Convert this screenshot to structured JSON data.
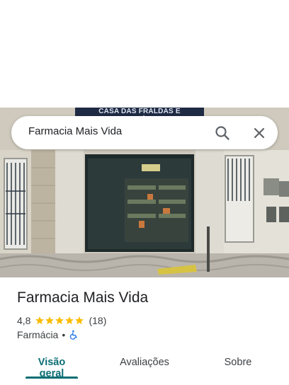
{
  "photo": {
    "sign_text": "CASA DAS FRALDAS E ORTOPÉDICA"
  },
  "search": {
    "query": "Farmacia Mais Vida",
    "icons": [
      "search-icon",
      "close-icon"
    ]
  },
  "place": {
    "name": "Farmacia Mais Vida",
    "rating": "4,8",
    "stars": 5,
    "review_count": "(18)",
    "category": "Farmácia",
    "separator": "•",
    "accessibility_icon": "wheelchair-icon"
  },
  "tabs": [
    {
      "label": "Visão geral",
      "active": true
    },
    {
      "label": "Avaliações",
      "active": false
    },
    {
      "label": "Sobre",
      "active": false
    }
  ],
  "colors": {
    "accent": "#0b6e73",
    "star": "#fbbc04",
    "wheelchair": "#1a73e8"
  }
}
